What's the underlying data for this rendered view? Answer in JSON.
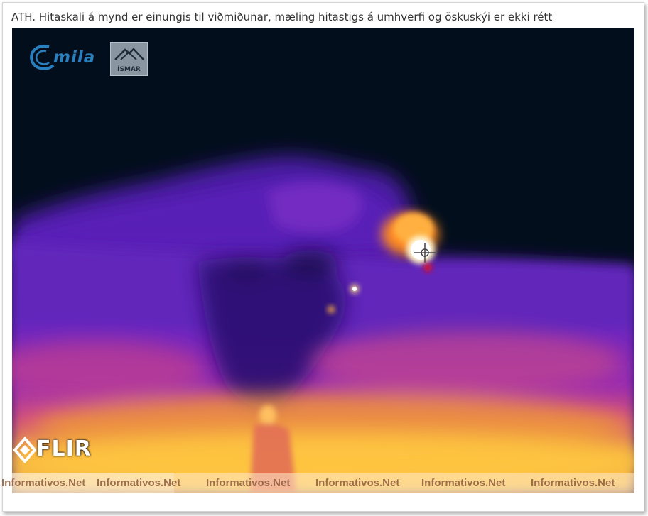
{
  "caption": "ATH. Hitaskali á mynd er einungis til viðmiðunar, mæling hitastigs á umhverfi og öskuskýi er ekki rétt",
  "logos": {
    "mila": "mila",
    "ismar": "ÍSMAR",
    "flir": "FLIR"
  },
  "watermarks": [
    "Informativos.Net",
    "Informativos.Net",
    "Informativos.Net",
    "Informativos.Net",
    "Informativos.Net",
    "Informativos.Net"
  ],
  "colors": {
    "sky": "#020e1c",
    "plume": "#5a1fb5",
    "hot": "#ffd54a",
    "accent_red": "#e01020"
  }
}
